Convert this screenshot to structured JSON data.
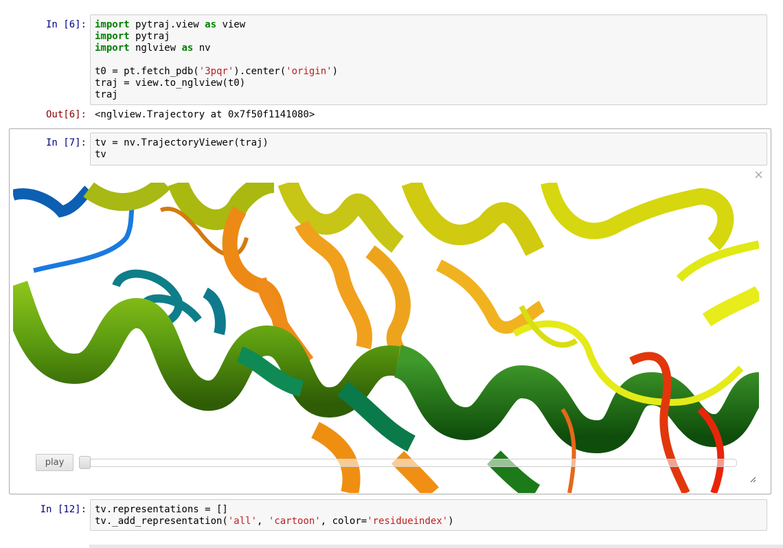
{
  "cells": [
    {
      "in_prompt": "In [6]:",
      "code_lines": [
        [
          {
            "t": "import",
            "k": "kw"
          },
          {
            "t": " pytraj.view "
          },
          {
            "t": "as",
            "k": "kw"
          },
          {
            "t": " view"
          }
        ],
        [
          {
            "t": "import",
            "k": "kw"
          },
          {
            "t": " pytraj"
          }
        ],
        [
          {
            "t": "import",
            "k": "kw"
          },
          {
            "t": " nglview "
          },
          {
            "t": "as",
            "k": "kw"
          },
          {
            "t": " nv"
          }
        ],
        [
          {
            "t": ""
          }
        ],
        [
          {
            "t": "t0 = pt.fetch_pdb("
          },
          {
            "t": "'3pqr'",
            "k": "str"
          },
          {
            "t": ").center("
          },
          {
            "t": "'origin'",
            "k": "str"
          },
          {
            "t": ")"
          }
        ],
        [
          {
            "t": "traj = view.to_nglview(t0)"
          }
        ],
        [
          {
            "t": "traj"
          }
        ]
      ],
      "out_prompt": "Out[6]:",
      "output": "<nglview.Trajectory at 0x7f50f1141080>"
    },
    {
      "in_prompt": "In [7]:",
      "code_lines": [
        [
          {
            "t": "tv = nv.TrajectoryViewer(traj)"
          }
        ],
        [
          {
            "t": "tv"
          }
        ]
      ]
    },
    {
      "in_prompt": "In [12]:",
      "code_lines": [
        [
          {
            "t": "tv.representations = []"
          }
        ],
        [
          {
            "t": "tv._add_representation("
          },
          {
            "t": "'all'",
            "k": "str"
          },
          {
            "t": ", "
          },
          {
            "t": "'cartoon'",
            "k": "str"
          },
          {
            "t": ", color="
          },
          {
            "t": "'residueindex'",
            "k": "str"
          },
          {
            "t": ")"
          }
        ]
      ]
    }
  ],
  "widget": {
    "close_symbol": "×",
    "play_label": "play",
    "slider_value": 0
  },
  "colors": {
    "keyword": "#008000",
    "string": "#ba2121",
    "in_prompt": "#000080",
    "out_prompt": "#8b0000"
  }
}
